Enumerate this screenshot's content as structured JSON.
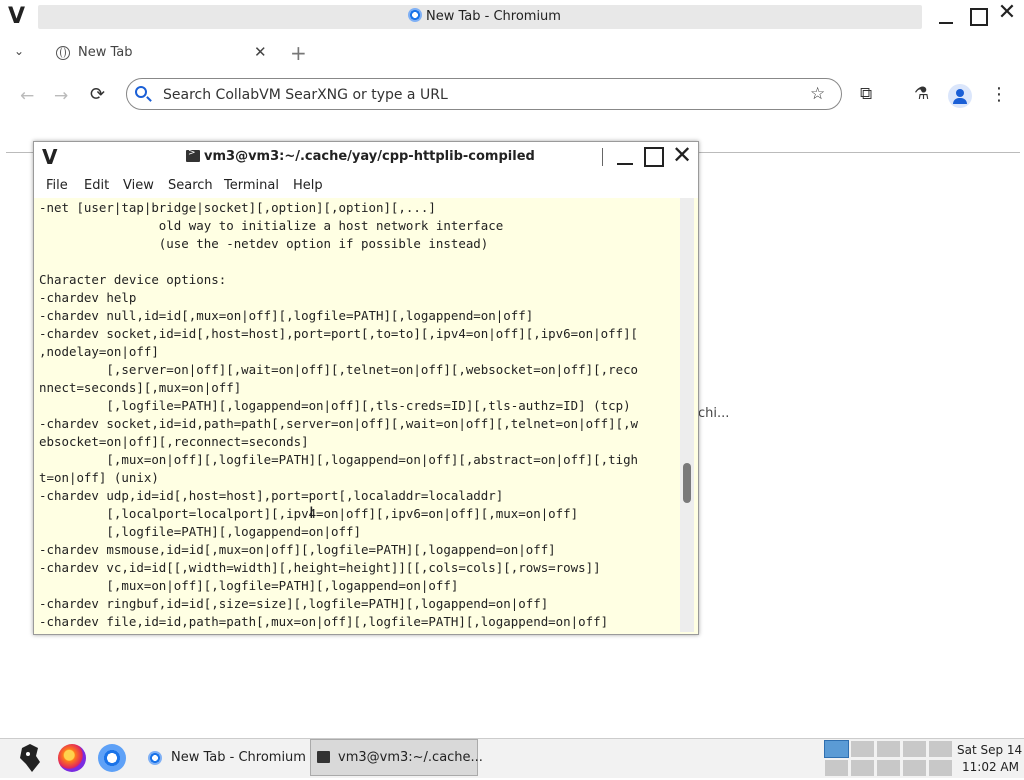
{
  "browser": {
    "window_title": "New Tab - Chromium",
    "tab_label": "New Tab",
    "tab_close": "✕",
    "new_tab": "+",
    "omnibox_placeholder": "Search CollabVM SearXNG or type a URL",
    "background_truncated": "chi..."
  },
  "terminal": {
    "title": "vm3@vm3:~/.cache/yay/cpp-httplib-compiled",
    "menu": [
      "File",
      "Edit",
      "View",
      "Search",
      "Terminal",
      "Help"
    ],
    "lines": [
      "-net [user|tap|bridge|socket][,option][,option][,...]",
      "                old way to initialize a host network interface",
      "                (use the -netdev option if possible instead)",
      "",
      "Character device options:",
      "-chardev help",
      "-chardev null,id=id[,mux=on|off][,logfile=PATH][,logappend=on|off]",
      "-chardev socket,id=id[,host=host],port=port[,to=to][,ipv4=on|off][,ipv6=on|off][",
      ",nodelay=on|off]",
      "         [,server=on|off][,wait=on|off][,telnet=on|off][,websocket=on|off][,reco",
      "nnect=seconds][,mux=on|off]",
      "         [,logfile=PATH][,logappend=on|off][,tls-creds=ID][,tls-authz=ID] (tcp)",
      "-chardev socket,id=id,path=path[,server=on|off][,wait=on|off][,telnet=on|off][,w",
      "ebsocket=on|off][,reconnect=seconds]",
      "         [,mux=on|off][,logfile=PATH][,logappend=on|off][,abstract=on|off][,tigh",
      "t=on|off] (unix)",
      "-chardev udp,id=id[,host=host],port=port[,localaddr=localaddr]",
      "         [,localport=localport][,ipv4=on|off][,ipv6=on|off][,mux=on|off]",
      "         [,logfile=PATH][,logappend=on|off]",
      "-chardev msmouse,id=id[,mux=on|off][,logfile=PATH][,logappend=on|off]",
      "-chardev vc,id=id[[,width=width][,height=height]][[,cols=cols][,rows=rows]]",
      "         [,mux=on|off][,logfile=PATH][,logappend=on|off]",
      "-chardev ringbuf,id=id[,size=size][,logfile=PATH][,logappend=on|off]",
      "-chardev file,id=id,path=path[,mux=on|off][,logfile=PATH][,logappend=on|off]"
    ]
  },
  "taskbar": {
    "tasks": [
      {
        "label": "New Tab - Chromium",
        "active": false
      },
      {
        "label": "vm3@vm3:~/.cache...",
        "active": true
      }
    ],
    "active_workspace": 1,
    "clock_date": "Sat Sep 14",
    "clock_time": "11:02 AM"
  },
  "colors": {
    "terminal_bg": "#ffffe3",
    "accent": "#1a73e8",
    "active_workspace": "#5b9bd5"
  },
  "icons": {
    "window_logo": "V",
    "close": "✕",
    "back": "←",
    "forward": "→",
    "reload": "⟳",
    "star": "☆",
    "extensions": "⧉",
    "labs": "⚗",
    "menu": "⋮",
    "tab_list": "⌄",
    "cursor": "I"
  }
}
